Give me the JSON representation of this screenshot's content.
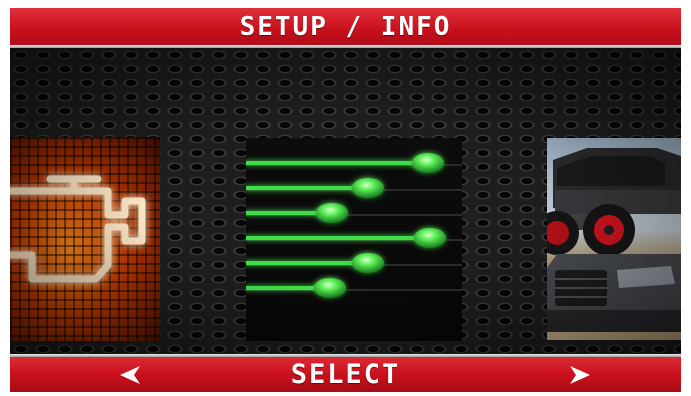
{
  "header": {
    "title": "SETUP / INFO"
  },
  "footer": {
    "select_label": "SELECT",
    "prev_icon": "arrow-left-icon",
    "next_icon": "arrow-right-icon"
  },
  "carousel": {
    "items": [
      {
        "icon": "check-engine-icon",
        "state": "partially-visible"
      },
      {
        "icon": "settings-sliders-icon",
        "state": "selected"
      },
      {
        "icon": "trucks-photo",
        "state": "partially-visible"
      }
    ]
  },
  "colors": {
    "bar_red": "#c8101c",
    "slider_green": "#3fdd4a",
    "engine_glow": "#ff8a1a"
  }
}
